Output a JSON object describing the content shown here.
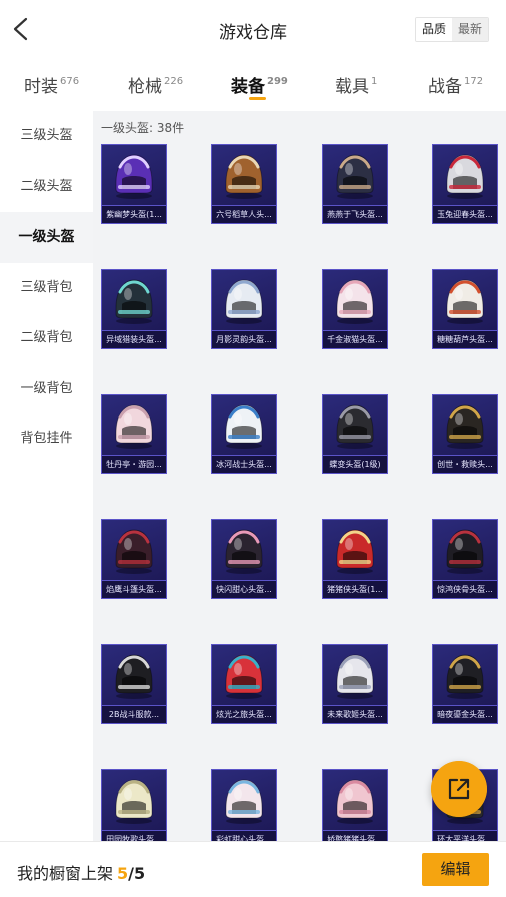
{
  "header": {
    "title": "游戏仓库",
    "sort_options": [
      "品质",
      "最新"
    ]
  },
  "tabs": [
    {
      "label": "时装",
      "count": "676"
    },
    {
      "label": "枪械",
      "count": "226"
    },
    {
      "label": "装备",
      "count": "299"
    },
    {
      "label": "载具",
      "count": "1"
    },
    {
      "label": "战备",
      "count": "172"
    }
  ],
  "sidebar": {
    "items": [
      "三级头盔",
      "二级头盔",
      "一级头盔",
      "三级背包",
      "二级背包",
      "一级背包",
      "背包挂件"
    ],
    "active_index": 2
  },
  "content": {
    "section_label": "一级头盔: 38件",
    "items": [
      {
        "name": "紫幽梦头盔(1...",
        "shell": "#5a2fb5",
        "accent": "#e0d0ff"
      },
      {
        "name": "六号稻草人头...",
        "shell": "#a0622e",
        "accent": "#e9d7b5"
      },
      {
        "name": "燕燕于飞头盔...",
        "shell": "#2c2f44",
        "accent": "#c9a98a"
      },
      {
        "name": "玉兔迎春头盔...",
        "shell": "#d9d9de",
        "accent": "#c8283a"
      },
      {
        "name": "异域猎装头盔...",
        "shell": "#24313a",
        "accent": "#6fd7d0"
      },
      {
        "name": "月影灵韵头盔...",
        "shell": "#e6ebf2",
        "accent": "#8fa8cf"
      },
      {
        "name": "千金淑猫头盔...",
        "shell": "#f4e3ea",
        "accent": "#e6a6b8"
      },
      {
        "name": "糖糖葫芦头盔...",
        "shell": "#f0ece6",
        "accent": "#d2502e"
      },
      {
        "name": "牡丹亭・游园...",
        "shell": "#f1d7dd",
        "accent": "#c9a0ae"
      },
      {
        "name": "冰河战士头盔...",
        "shell": "#eef2f6",
        "accent": "#3b7fc9"
      },
      {
        "name": "蝶变头盔(1级)",
        "shell": "#2b2b30",
        "accent": "#9a9aa6"
      },
      {
        "name": "创世・救赎头...",
        "shell": "#2a2622",
        "accent": "#d0a54a"
      },
      {
        "name": "焰鹰斗篷头盔...",
        "shell": "#3a1e2a",
        "accent": "#b8323f"
      },
      {
        "name": "快闪甜心头盔...",
        "shell": "#2b2430",
        "accent": "#e89ab8"
      },
      {
        "name": "猪猪侠头盔(1...",
        "shell": "#c92a2a",
        "accent": "#f2d48a"
      },
      {
        "name": "惊鸿侠骨头盔...",
        "shell": "#1f1d24",
        "accent": "#b8323f"
      },
      {
        "name": "2B战斗服款...",
        "shell": "#1e1e22",
        "accent": "#d7d7d7"
      },
      {
        "name": "炫光之旅头盔...",
        "shell": "#d8323a",
        "accent": "#3ab0c8"
      },
      {
        "name": "未来歌姬头盔...",
        "shell": "#e6e6ec",
        "accent": "#9aa0b8"
      },
      {
        "name": "暗夜鎏金头盔...",
        "shell": "#1f1f24",
        "accent": "#cfa54a"
      },
      {
        "name": "田园牧歌头盔...",
        "shell": "#ece8c8",
        "accent": "#b9b284"
      },
      {
        "name": "彩虹甜心头盔...",
        "shell": "#f3e6ec",
        "accent": "#7ab6e0"
      },
      {
        "name": "娇憨猪猪头盔...",
        "shell": "#f0c6d0",
        "accent": "#d98aa0"
      },
      {
        "name": "环太平洋头盔...",
        "shell": "#2a2a30",
        "accent": "#d8a640"
      }
    ]
  },
  "footer": {
    "label": "我的橱窗上架",
    "current": "5",
    "separator": "/",
    "max": "5",
    "edit_label": "编辑"
  },
  "colors": {
    "accent": "#f5a410",
    "card_bg": "#231f66",
    "card_border": "#5b54c8"
  },
  "icons": {
    "back": "chevron-left-icon",
    "share": "share-out-icon"
  }
}
